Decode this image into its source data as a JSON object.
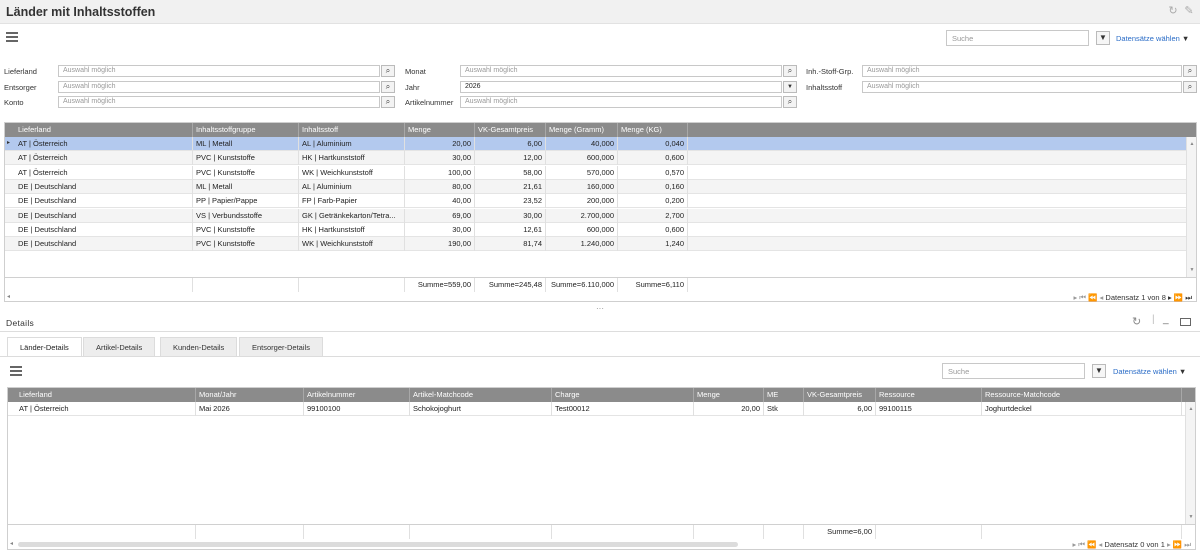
{
  "window": {
    "title": "Länder mit Inhaltsstoffen"
  },
  "top_toolbar": {
    "search_placeholder": "Suche",
    "datasets_label": "Datensätze wählen"
  },
  "filters": {
    "col1": [
      {
        "label": "Lieferland",
        "placeholder": "Auswahl möglich"
      },
      {
        "label": "Entsorger",
        "placeholder": "Auswahl möglich"
      },
      {
        "label": "Konto",
        "placeholder": "Auswahl möglich"
      }
    ],
    "col2": [
      {
        "label": "Monat",
        "value": "Auswahl möglich",
        "placeholder": true,
        "button": "search"
      },
      {
        "label": "Jahr",
        "value": "2026",
        "placeholder": false,
        "button": "dropdown"
      },
      {
        "label": "Artikelnummer",
        "value": "Auswahl möglich",
        "placeholder": true,
        "button": "search"
      }
    ],
    "col3": [
      {
        "label": "Inh.-Stoff-Grp.",
        "placeholder": "Auswahl möglich"
      },
      {
        "label": "Inhaltsstoff",
        "placeholder": "Auswahl möglich"
      }
    ]
  },
  "main_grid": {
    "columns": [
      "Lieferland",
      "Inhaltsstoffgruppe",
      "Inhaltsstoff",
      "Menge",
      "VK-Gesamtpreis",
      "Menge (Gramm)",
      "Menge (KG)"
    ],
    "rows": [
      [
        "AT | Österreich",
        "ML | Metall",
        "AL | Aluminium",
        "20,00",
        "6,00",
        "40,000",
        "0,040"
      ],
      [
        "AT | Österreich",
        "PVC | Kunststoffe",
        "HK | Hartkunststoff",
        "30,00",
        "12,00",
        "600,000",
        "0,600"
      ],
      [
        "AT | Österreich",
        "PVC | Kunststoffe",
        "WK | Weichkunststoff",
        "100,00",
        "58,00",
        "570,000",
        "0,570"
      ],
      [
        "DE | Deutschland",
        "ML | Metall",
        "AL | Aluminium",
        "80,00",
        "21,61",
        "160,000",
        "0,160"
      ],
      [
        "DE | Deutschland",
        "PP | Papier/Pappe",
        "FP | Farb-Papier",
        "40,00",
        "23,52",
        "200,000",
        "0,200"
      ],
      [
        "DE | Deutschland",
        "VS | Verbundsstoffe",
        "GK | Getränkekarton/Tetra...",
        "69,00",
        "30,00",
        "2.700,000",
        "2,700"
      ],
      [
        "DE | Deutschland",
        "PVC | Kunststoffe",
        "HK | Hartkunststoff",
        "30,00",
        "12,61",
        "600,000",
        "0,600"
      ],
      [
        "DE | Deutschland",
        "PVC | Kunststoffe",
        "WK | Weichkunststoff",
        "190,00",
        "81,74",
        "1.240,000",
        "1,240"
      ]
    ],
    "selected_row": 0,
    "sums": [
      "",
      "",
      "",
      "Summe=559,00",
      "Summe=245,48",
      "Summe=6.110,000",
      "Summe=6,110"
    ],
    "pager": "Datensatz 1 von 8"
  },
  "details": {
    "title": "Details",
    "tabs": [
      "Länder-Details",
      "Artikel-Details",
      "Kunden-Details",
      "Entsorger-Details"
    ],
    "active_tab": 0,
    "search_placeholder": "Suche",
    "datasets_label": "Datensätze wählen",
    "grid": {
      "columns": [
        "Lieferland",
        "Monat/Jahr",
        "Artikelnummer",
        "Artikel-Matchcode",
        "Charge",
        "Menge",
        "ME",
        "VK-Gesamtpreis",
        "Ressource",
        "Ressource-Matchcode"
      ],
      "rows": [
        [
          "AT | Österreich",
          "Mai 2026",
          "99100100",
          "Schokojoghurt",
          "Test00012",
          "20,00",
          "Stk",
          "6,00",
          "99100115",
          "Joghurtdeckel"
        ]
      ],
      "sums": [
        "",
        "",
        "",
        "",
        "",
        "",
        "",
        "Summe=6,00",
        "",
        ""
      ],
      "pager": "Datensatz 0 von 1"
    }
  }
}
